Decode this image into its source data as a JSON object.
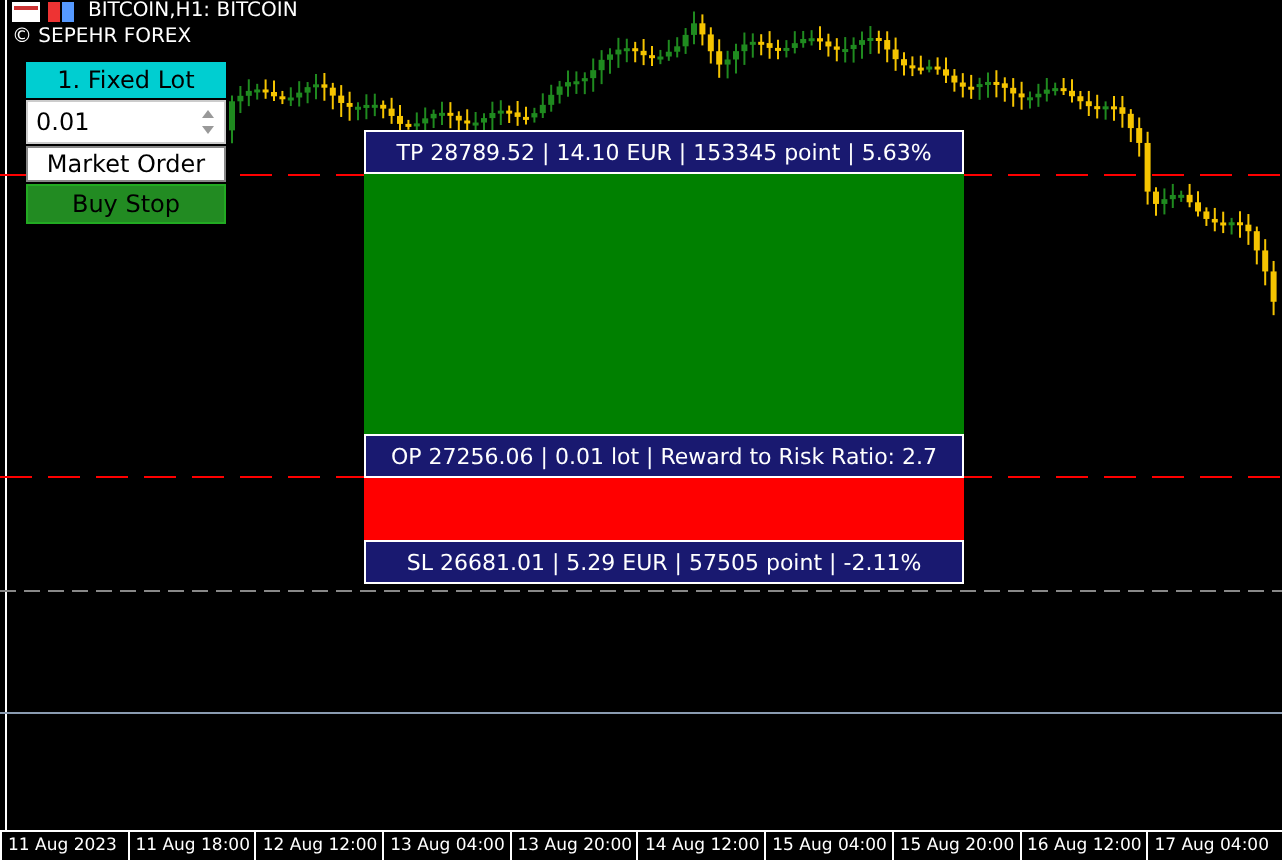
{
  "chart_title": "BITCOIN,H1: BITCOIN",
  "copyright": "© SEPEHR FOREX",
  "panel": {
    "mode_button": "1. Fixed Lot",
    "lot_input": "0.01",
    "order_type_button": "Market Order",
    "action_button": "Buy Stop"
  },
  "position": {
    "tp_label": "TP 28789.52 | 14.10 EUR | 153345 point | 5.63%",
    "op_label": "OP 27256.06 | 0.01 lot | Reward to Risk Ratio: 2.7",
    "sl_label": "SL 26681.01 | 5.29 EUR | 57505 point | -2.11%"
  },
  "time_axis": [
    "11 Aug 2023",
    "11 Aug 18:00",
    "12 Aug 12:00",
    "13 Aug 04:00",
    "13 Aug 20:00",
    "14 Aug 12:00",
    "15 Aug 04:00",
    "15 Aug 20:00",
    "16 Aug 12:00",
    "17 Aug 04:00"
  ]
}
